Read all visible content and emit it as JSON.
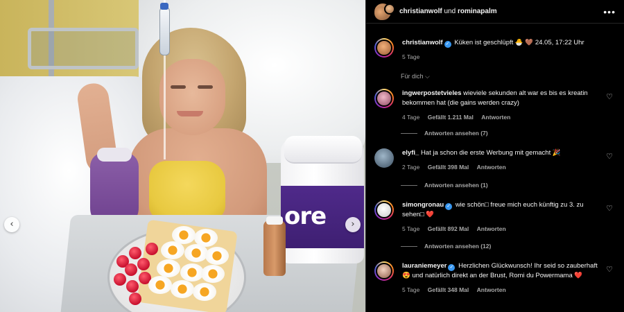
{
  "header": {
    "user1": "christianwolf",
    "connector": "und",
    "user2": "rominapalm",
    "more_icon": "more-dots-icon"
  },
  "caption": {
    "username": "christianwolf",
    "text": "Küken ist geschlüpft 🐣 🤎 24.05, 17:22 Uhr",
    "age": "5 Tage"
  },
  "translate_label": "Für dich",
  "photo": {
    "tub_text": "ore",
    "accent_purple": "#4f2a8a"
  },
  "comments": [
    {
      "username": "ingwerpostetvieles",
      "verified": false,
      "text": "wieviele sekunden alt war es bis es kreatin bekommen hat (die gains werden crazy)",
      "age": "4 Tage",
      "likes": "Gefällt 1.211 Mal",
      "reply": "Antworten",
      "view_replies": "Antworten ansehen (7)"
    },
    {
      "username": "elyfi_",
      "verified": false,
      "text": "Hat ja schon die erste Werbung mit gemacht 🎉",
      "age": "2 Tage",
      "likes": "Gefällt 398 Mal",
      "reply": "Antworten",
      "view_replies": "Antworten ansehen (1)"
    },
    {
      "username": "simongronau",
      "verified": true,
      "text": "wie schön□ freue mich euch künftig zu 3. zu sehen□ ❤️",
      "age": "5 Tage",
      "likes": "Gefällt 892 Mal",
      "reply": "Antworten",
      "view_replies": "Antworten ansehen (12)"
    },
    {
      "username": "lauraniemeyer",
      "verified": true,
      "text": "Herzlichen Glückwunsch! Ihr seid so zauberhaft 😍 und natürlich direkt an der Brust, Romi du Powermama ❤️",
      "age": "5 Tage",
      "likes": "Gefällt 348 Mal",
      "reply": "Antworten",
      "view_replies": ""
    }
  ]
}
